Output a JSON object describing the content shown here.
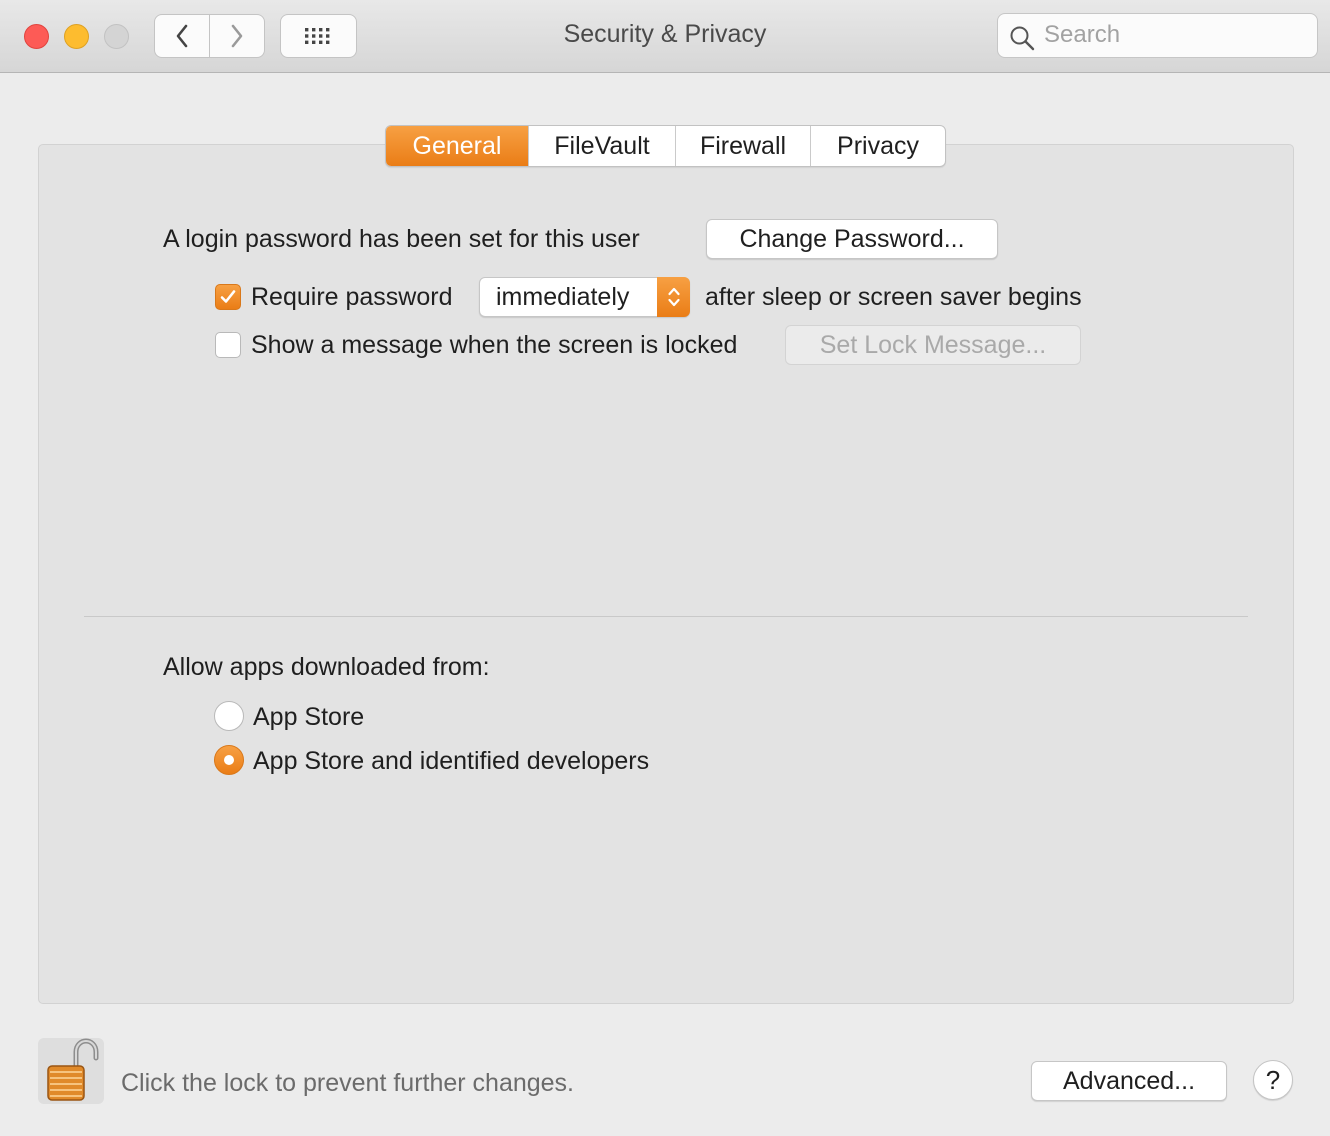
{
  "window": {
    "title": "Security & Privacy",
    "search_placeholder": "Search"
  },
  "toolbar": {
    "back_icon": "chevron-left-icon",
    "forward_icon": "chevron-right-icon",
    "grid_icon": "grid-icon"
  },
  "tabs": [
    {
      "label": "General",
      "active": true
    },
    {
      "label": "FileVault",
      "active": false
    },
    {
      "label": "Firewall",
      "active": false
    },
    {
      "label": "Privacy",
      "active": false
    }
  ],
  "general": {
    "login_password_text": "A login password has been set for this user",
    "change_password_label": "Change Password...",
    "require_password": {
      "checked": true,
      "label": "Require password",
      "selected_value": "immediately",
      "suffix": "after sleep or screen saver begins"
    },
    "show_message": {
      "checked": false,
      "label": "Show a message when the screen is locked",
      "button_label": "Set Lock Message...",
      "button_enabled": false
    },
    "allow_apps": {
      "heading": "Allow apps downloaded from:",
      "options": [
        {
          "label": "App Store",
          "selected": false
        },
        {
          "label": "App Store and identified developers",
          "selected": true
        }
      ]
    }
  },
  "footer": {
    "lock_text": "Click the lock to prevent further changes.",
    "advanced_label": "Advanced...",
    "help_label": "?"
  },
  "colors": {
    "accent": "#ef8a20",
    "close": "#fd5b56",
    "minimize": "#fdbc2f",
    "zoom_disabled": "#d4d4d4"
  }
}
